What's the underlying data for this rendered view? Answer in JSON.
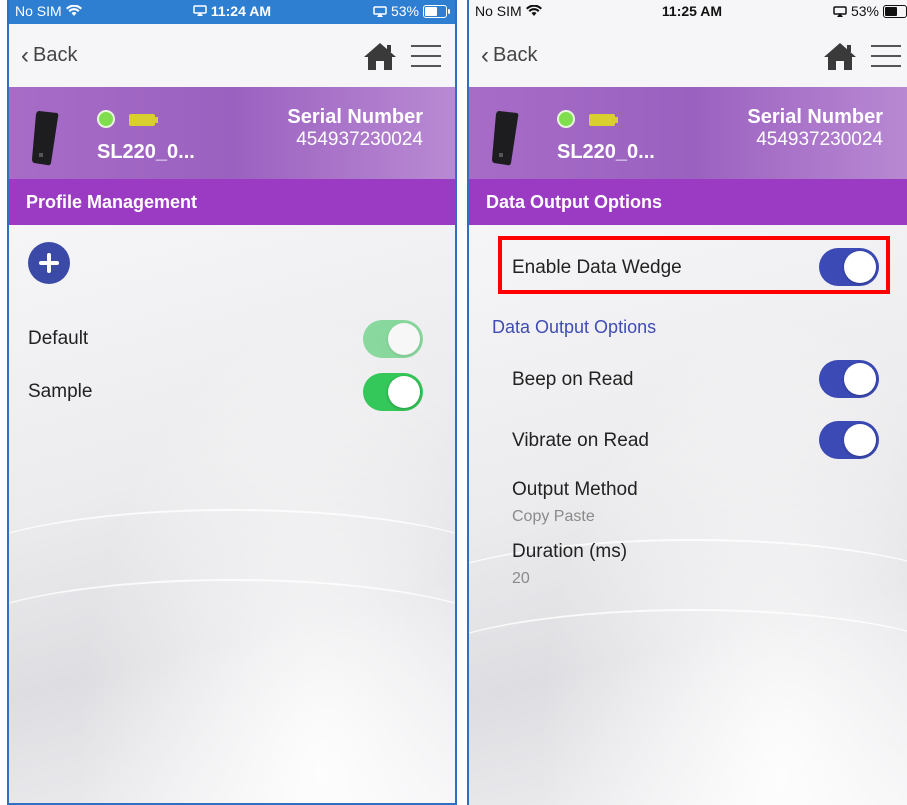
{
  "left_screen": {
    "status": {
      "carrier": "No SIM",
      "time": "11:24 AM",
      "battery": "53%"
    },
    "nav": {
      "back_label": "Back"
    },
    "device": {
      "name": "SL220_0...",
      "serial_label": "Serial Number",
      "serial_value": "454937230024"
    },
    "section_title": "Profile Management",
    "profiles": [
      {
        "label": "Default",
        "enabled": true
      },
      {
        "label": "Sample",
        "enabled": true
      }
    ]
  },
  "right_screen": {
    "status": {
      "carrier": "No SIM",
      "time": "11:25 AM",
      "battery": "53%"
    },
    "nav": {
      "back_label": "Back"
    },
    "device": {
      "name": "SL220_0...",
      "serial_label": "Serial Number",
      "serial_value": "454937230024"
    },
    "section_title": "Data Output Options",
    "enable_data_wedge": {
      "label": "Enable Data Wedge",
      "enabled": true
    },
    "group_title": "Data Output Options",
    "beep_on_read": {
      "label": "Beep on Read",
      "enabled": true
    },
    "vibrate_on_read": {
      "label": "Vibrate on Read",
      "enabled": true
    },
    "output_method": {
      "label": "Output Method",
      "value": "Copy Paste"
    },
    "duration": {
      "label": "Duration (ms)",
      "value": "20"
    }
  },
  "colors": {
    "accent_purple": "#9b3bc4",
    "toggle_green": "#34c759",
    "toggle_blue": "#3c4ab6",
    "highlight_red": "#ff0000"
  },
  "icons": [
    "wifi-icon",
    "screen-mirror-icon",
    "battery-icon",
    "chevron-left-icon",
    "home-icon",
    "hamburger-menu-icon",
    "scanner-device-icon",
    "connection-status-icon",
    "device-battery-icon",
    "plus-icon"
  ]
}
